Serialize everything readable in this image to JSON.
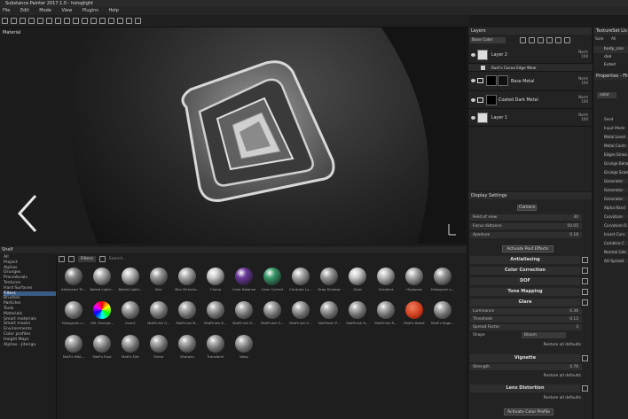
{
  "window": {
    "title": "Substance Painter 2017.1.0 - hologlight"
  },
  "menu": [
    "File",
    "Edit",
    "Mode",
    "View",
    "Plugins",
    "Help"
  ],
  "viewport": {
    "label": "Material"
  },
  "layers_panel": {
    "title": "Layers",
    "blend_select": "Base Color",
    "layers": [
      {
        "name": "Layer 2",
        "blend": "Norm",
        "opacity": "100"
      },
      {
        "name": "Rust's Cocoa Edge Wear",
        "blend": "",
        "opacity": ""
      },
      {
        "name": "Base Metal",
        "blend": "Norm",
        "opacity": "100"
      },
      {
        "name": "Coated Dark Metal",
        "blend": "Norm",
        "opacity": "100"
      },
      {
        "name": "Layer 1",
        "blend": "Norm",
        "opacity": "100"
      }
    ]
  },
  "display_settings": {
    "title": "Display Settings",
    "camera_button": "Camera",
    "params": [
      {
        "label": "Field of view",
        "value": "30"
      },
      {
        "label": "Focus distance",
        "value": "50.05"
      },
      {
        "label": "Aperture",
        "value": "0.18"
      }
    ],
    "post_effects_button": "Activate Post Effects",
    "sections": {
      "antialiasing": "Antialiasing",
      "color_correction": "Color Correction",
      "dof": "DOF",
      "tone_mapping": "Tone Mapping",
      "glare": "Glare",
      "vignette": "Vignette",
      "lens_distortion": "Lens Distortion"
    },
    "glare": {
      "luminance_label": "Luminance",
      "luminance_value": "0.36",
      "threshold_label": "Threshold",
      "threshold_value": "0.12",
      "spread_label": "Spread Factor",
      "spread_value": "3",
      "shape_label": "Shape",
      "shape_value": "Bloom"
    },
    "vignette": {
      "strength_label": "Strength",
      "strength_value": "0.76"
    },
    "restore": "Restore all defaults",
    "color_profile_button": "Activate Color Profile"
  },
  "shelf": {
    "title": "Shelf",
    "filter_tab": "Filters",
    "search_placeholder": "Search...",
    "categories": [
      "All",
      "Project",
      "Alphas",
      "Grunges",
      "Procedurals",
      "Textures",
      "Hard Surfaces",
      "Filters",
      "Brushes",
      "Particles",
      "Tools",
      "Materials",
      "Smart materials",
      "Smart masks",
      "Environments",
      "Color profiles",
      "Height Maps",
      "Alphas - Jiteriga"
    ],
    "selected_category": "Filters",
    "items": [
      "Advanced Til...",
      "Baked Lighti...",
      "Baked Lighti...",
      "Blur",
      "Blur Directio...",
      "Clamp",
      "Color Balance",
      "Color Correct",
      "Contrast Lu...",
      "Drop Shadow",
      "Glow",
      "Gradient",
      "Highpass",
      "Histogram s...",
      "Histogram s...",
      "HSL Percept...",
      "Invert",
      "MatFinish G...",
      "MatFinish B...",
      "MatFinish D...",
      "MatFinish G...",
      "MatFinish G...",
      "MatFinish G...",
      "MatFinish P...",
      "MatFinish R...",
      "MatFinish R...",
      "MatFx Beast",
      "MatFx Edge...",
      "MatFx HBA...",
      "MatFx Rust",
      "MatFx Dirt",
      "Mirror",
      "Sharpen",
      "Transform",
      "Warp"
    ]
  },
  "texture_set": {
    "title": "TextureSet Lis",
    "tab1": "Sole",
    "tab2": "All",
    "items": [
      "body_con",
      "dial",
      "Exterl"
    ]
  },
  "properties": {
    "title": "Properties - Fil",
    "tab": "color",
    "fields": [
      "Seed",
      "Input Mode",
      "Metal Level",
      "Metal Contr",
      "Edges Smoo",
      "Grunge Balan",
      "Grunge Scale",
      "Generator",
      "Generator",
      "Generator",
      "Alpha Rand",
      "Curvature",
      "Curvature O",
      "Invert Curv",
      "Combine C",
      "Normal Gde",
      "AO Spread"
    ]
  },
  "colors": {
    "accent": "#3a5b86",
    "panel": "#232323",
    "viewport": "#0b0b0b"
  }
}
